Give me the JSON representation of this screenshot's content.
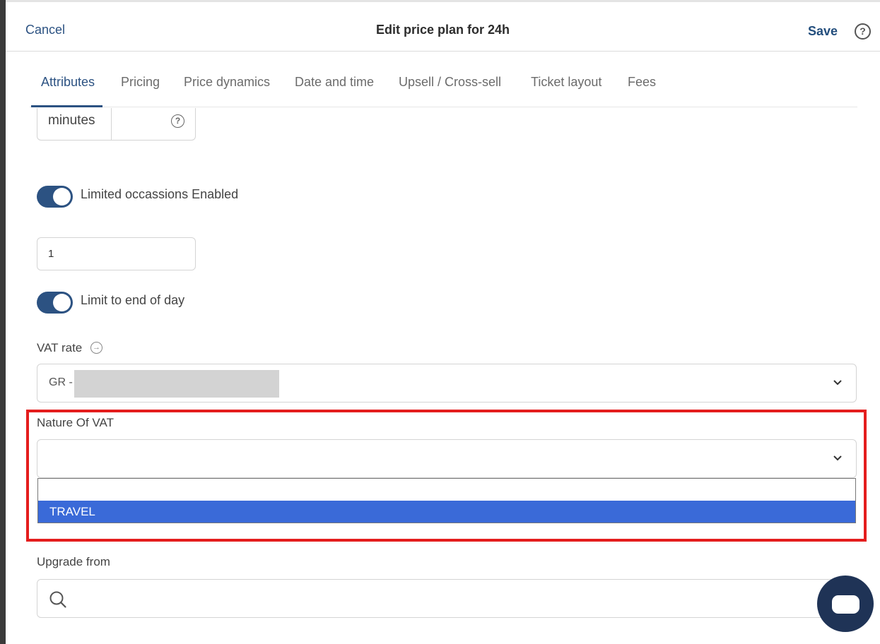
{
  "header": {
    "cancel_label": "Cancel",
    "title": "Edit price plan for 24h",
    "save_label": "Save",
    "help_glyph": "?"
  },
  "tabs": [
    {
      "label": "Attributes",
      "active": true
    },
    {
      "label": "Pricing"
    },
    {
      "label": "Price dynamics"
    },
    {
      "label": "Date and time"
    },
    {
      "label": "Upsell / Cross-sell"
    },
    {
      "label": "Ticket layout"
    },
    {
      "label": "Fees"
    }
  ],
  "duration": {
    "unit_label": "minutes",
    "help_glyph": "?"
  },
  "limited_occasions": {
    "label": "Limited occassions Enabled",
    "enabled": true
  },
  "occasions_count": {
    "value": "1"
  },
  "limit_end_of_day": {
    "label": "Limit to end of day",
    "enabled": true
  },
  "vat_rate": {
    "label": "VAT rate",
    "value_prefix": "GR -",
    "icon": "arrow-right-circle-icon"
  },
  "nature_of_vat": {
    "label": "Nature Of VAT",
    "selected": "",
    "options": [
      "",
      "TRAVEL"
    ],
    "highlighted_option": "TRAVEL"
  },
  "upgrade_from": {
    "label": "Upgrade from",
    "value": ""
  },
  "colors": {
    "accent": "#2c5282",
    "highlight_option": "#3a6ad8",
    "annotation_frame": "#e41d1d",
    "chat_button": "#1f3356"
  }
}
